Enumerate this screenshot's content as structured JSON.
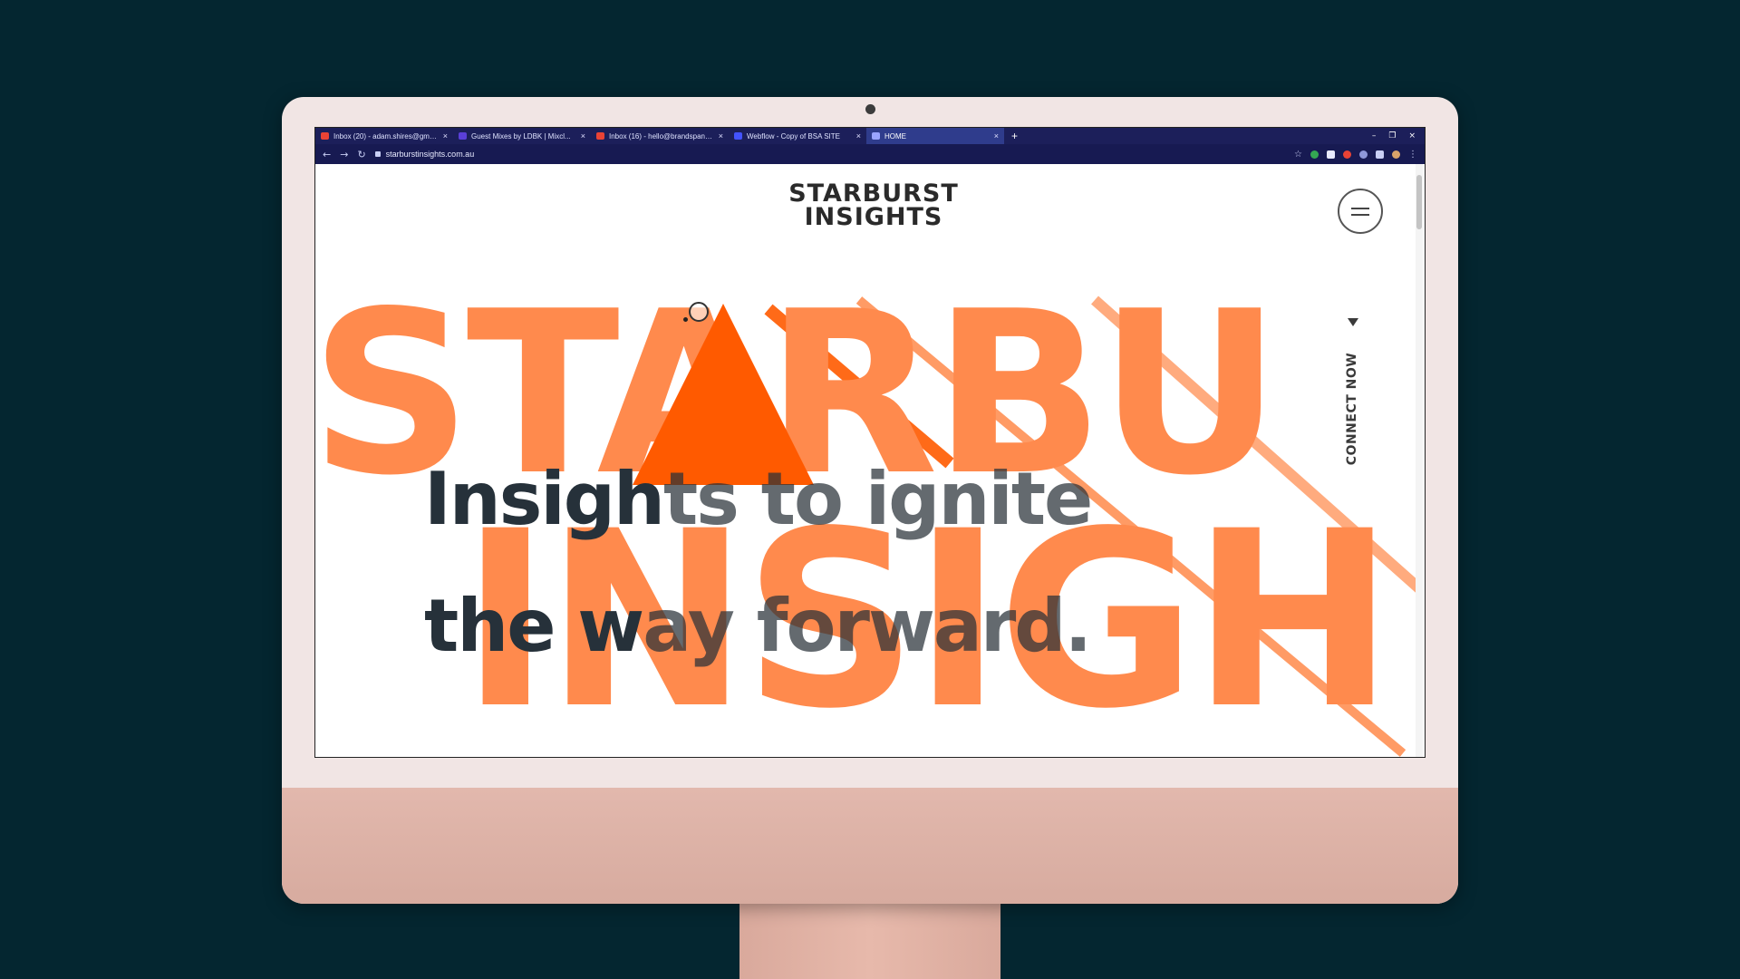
{
  "colors": {
    "background": "#042630",
    "imac_body": "#f1e5e4",
    "imac_chin": "#d7ab9f",
    "brand_orange": "#ff5a00",
    "light_orange": "#ff8a4d",
    "headline_dark": "#26313a"
  },
  "browser": {
    "tabs": [
      {
        "icon": "gmail-icon",
        "title": "Inbox (20) - adam.shires@gmail...",
        "active": false,
        "favicon_color": "#ea4335"
      },
      {
        "icon": "mixcloud-icon",
        "title": "Guest Mixes by LDBK | Mixcl...",
        "active": false,
        "favicon_color": "#5a3fd8"
      },
      {
        "icon": "gmail-icon",
        "title": "Inbox (16) - hello@brandspanki...",
        "active": false,
        "favicon_color": "#ea4335"
      },
      {
        "icon": "webflow-icon",
        "title": "Webflow - Copy of BSA SITE",
        "active": false,
        "favicon_color": "#4353ff"
      },
      {
        "icon": "site-icon",
        "title": "HOME",
        "active": true,
        "favicon_color": "#9aa4ff"
      }
    ],
    "new_tab": "+",
    "close_glyph": "×",
    "window_controls": [
      "–",
      "❐",
      "×"
    ],
    "url": "starburstinsights.com.au"
  },
  "page": {
    "logo": {
      "line1": "STARBURST",
      "line2": "INSIGHTS"
    },
    "background_words": {
      "top": "STARBU",
      "bottom": "INSIGH"
    },
    "headline": {
      "line1_dark": "Insigh",
      "line1_rest": "ts to ignite",
      "line2_dark": "the w",
      "line2_rest": "ay forward."
    },
    "connect_label": "CONNECT NOW",
    "menu_icon": "hamburger-icon"
  }
}
